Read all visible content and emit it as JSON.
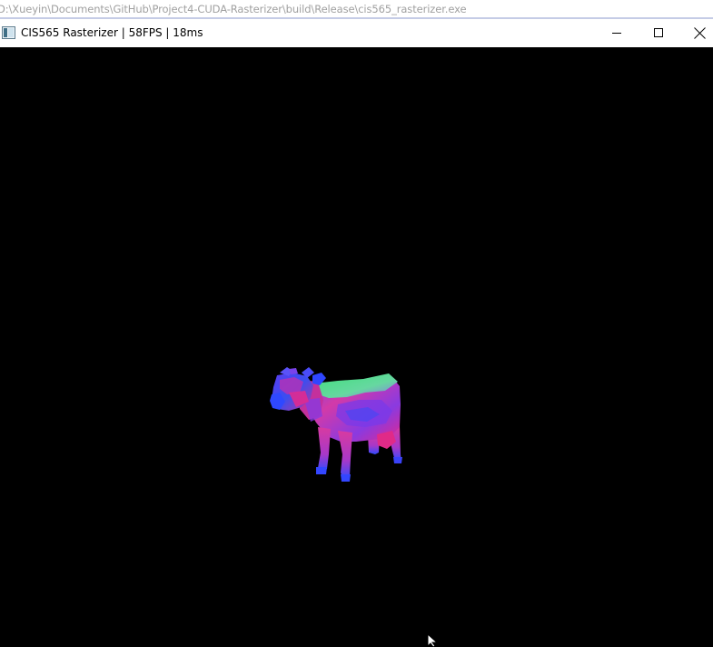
{
  "console": {
    "path": "D:\\Xueyin\\Documents\\GitHub\\Project4-CUDA-Rasterizer\\build\\Release\\cis565_rasterizer.exe"
  },
  "window": {
    "title": "CIS565 Rasterizer | 58FPS  |  18ms",
    "icon": "app-window-icon",
    "controls": [
      "minimize-icon",
      "maximize-icon",
      "close-icon"
    ]
  },
  "viewport": {
    "background": "#000000",
    "model": "cow",
    "shading": "normal-colors"
  },
  "colors": {
    "magenta": "#e0289a",
    "violet": "#7a35e8",
    "blue": "#2f4bff",
    "green": "#3fe07a"
  }
}
